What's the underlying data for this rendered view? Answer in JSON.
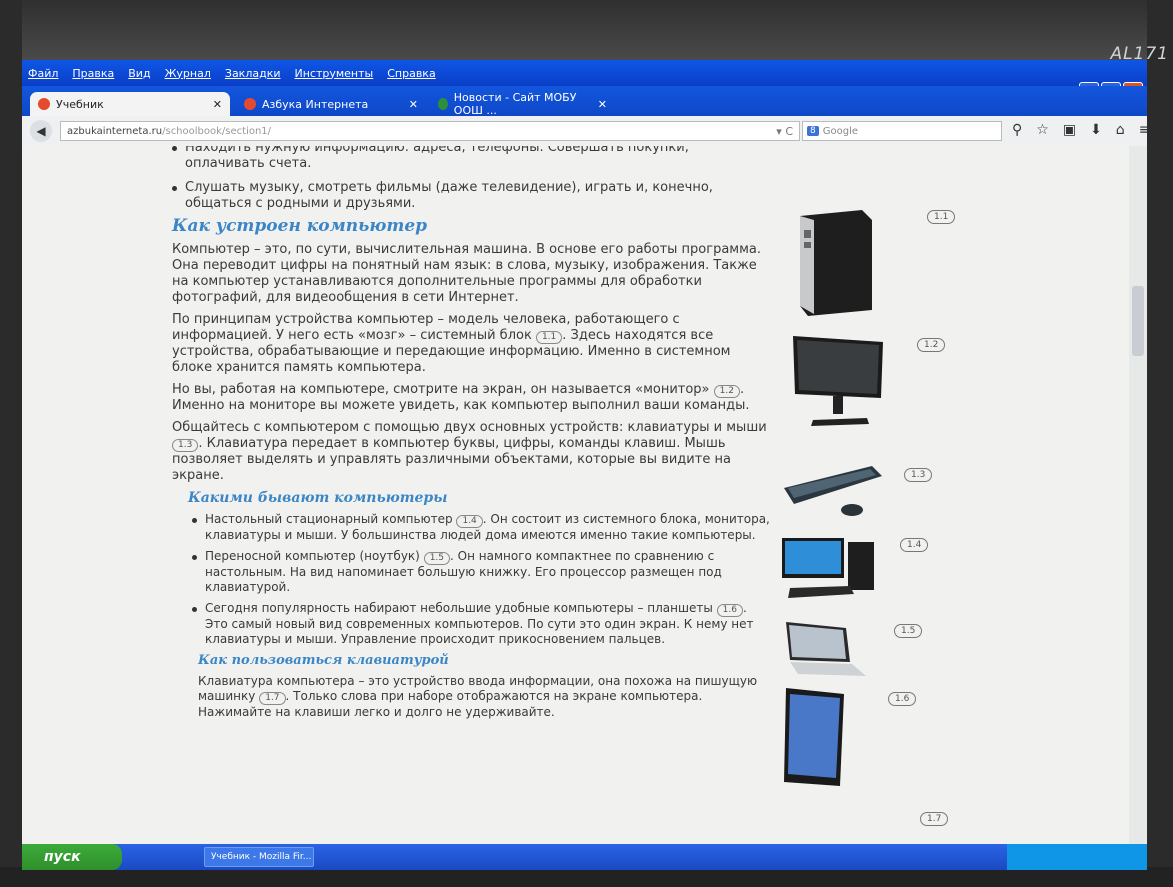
{
  "monitor": {
    "brand": "AL171"
  },
  "menu": [
    "Файл",
    "Правка",
    "Вид",
    "Журнал",
    "Закладки",
    "Инструменты",
    "Справка"
  ],
  "tabs": [
    {
      "title": "Учебник",
      "active": true
    },
    {
      "title": "Азбука Интернета",
      "active": false
    },
    {
      "title": "Новости - Сайт МОБУ ООШ ...",
      "active": false
    }
  ],
  "navbar": {
    "url_domain": "azbukainterneta.ru",
    "url_path": "/schoolbook/section1/",
    "search_engine": "Google",
    "search_placeholder": "Google"
  },
  "page": {
    "bullet_top_1": "Находить нужную информацию: адреса, телефоны. Совершать покупки, оплачивать счета.",
    "bullet_top_2": "Слушать музыку, смотреть фильмы (даже телевидение), играть и, конечно, общаться с родными и друзьями.",
    "heading_1": "Как устроен компьютер",
    "para_1": "Компьютер – это, по сути, вычислительная машина. В основе его работы программа. Она переводит цифры на понятный нам язык: в слова, музыку, изображения. Также на компьютер устанавливаются дополнительные программы для обработки фотографий, для видеообщения в сети Интернет.",
    "para_2a": "По принципам устройства компьютер – модель человека, работающего с информацией. У него есть «мозг» – системный блок",
    "para_2b": ". Здесь находятся все устройства, обрабатывающие и передающие информацию. Именно в системном блоке хранится память компьютера.",
    "para_3a": "Но вы, работая на компьютере, смотрите на экран, он называется «монитор»",
    "para_3b": ". Именно на мониторе вы можете увидеть, как компьютер выполнил ваши команды.",
    "para_4a": "Общайтесь с компьютером с помощью двух основных устройств: клавиатуры и мыши",
    "para_4b": ". Клавиатура передает в компьютер буквы, цифры, команды клавиш. Мышь позволяет выделять и управлять различными объектами, которые вы видите на экране.",
    "heading_2": "Какими бывают компьютеры",
    "bullet_a_1": "Настольный стационарный компьютер",
    "bullet_a_2": ". Он состоит из системного блока, монитора, клавиатуры и мыши. У большинства людей дома имеются именно такие компьютеры.",
    "bullet_b_1": "Переносной компьютер (ноутбук)",
    "bullet_b_2": ". Он намного компактнее по сравнению с настольным. На вид напоминает большую книжку. Его процессор размещен под клавиатурой.",
    "bullet_c_1": "Сегодня популярность набирают небольшие удобные компьютеры – планшеты",
    "bullet_c_2": ". Это самый новый вид современных компьютеров. По сути это один экран. К нему нет клавиатуры и мыши. Управление происходит прикосновением пальцев.",
    "heading_3": "Как пользоваться клавиатурой",
    "para_5a": "Клавиатура компьютера – это устройство ввода информации, она похожа на пишущую машинку",
    "para_5b": ". Только слова при наборе отображаются на экране компьютера. Нажимайте на клавиши легко и долго не удерживайте.",
    "refs": [
      "1.1",
      "1.2",
      "1.3",
      "1.4",
      "1.5",
      "1.6",
      "1.7"
    ]
  },
  "taskbar": {
    "start": "пуск",
    "item": "Учебник - Mozilla Fir..."
  }
}
